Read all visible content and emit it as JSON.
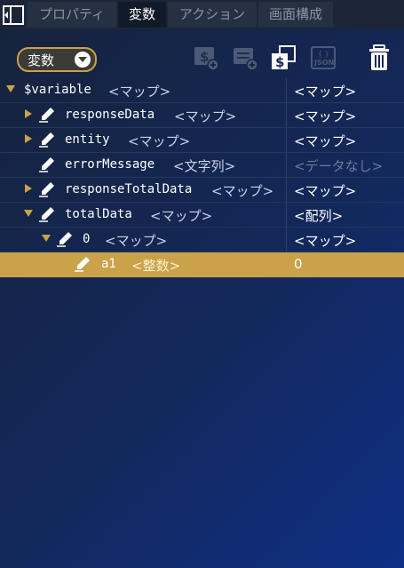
{
  "colors": {
    "accent": "#c9a24a",
    "background": "#13285a",
    "muted": "#6e7b93"
  },
  "tabs": [
    {
      "label": "プロパティ",
      "active": false
    },
    {
      "label": "変数",
      "active": true
    },
    {
      "label": "アクション",
      "active": false
    },
    {
      "label": "画面構成",
      "active": false
    }
  ],
  "toolbar": {
    "dropdown_label": "変数",
    "icons": [
      "add-variable-icon",
      "add-list-icon",
      "copy-variable-icon",
      "json-icon",
      "trash-icon"
    ],
    "json_label": "JSON"
  },
  "tree": [
    {
      "name": "$variable",
      "type": "<マップ>",
      "value": "<マップ>",
      "expanded": true,
      "editable": false
    },
    {
      "name": "responseData",
      "type": "<マップ>",
      "value": "<マップ>",
      "expanded": false,
      "editable": true
    },
    {
      "name": "entity",
      "type": "<マップ>",
      "value": "<マップ>",
      "expanded": false,
      "editable": true
    },
    {
      "name": "errorMessage",
      "type": "<文字列>",
      "value": "<データなし>",
      "editable": true
    },
    {
      "name": "responseTotalData",
      "type": "<マップ>",
      "value": "<マップ>",
      "expanded": false,
      "editable": true
    },
    {
      "name": "totalData",
      "type": "<マップ>",
      "value": "<配列>",
      "expanded": true,
      "editable": true
    },
    {
      "name": "0",
      "type": "<マップ>",
      "value": "<マップ>",
      "expanded": true,
      "editable": true
    },
    {
      "name": "a1",
      "type": "<整数>",
      "value": "0",
      "editable": true,
      "selected": true
    }
  ]
}
